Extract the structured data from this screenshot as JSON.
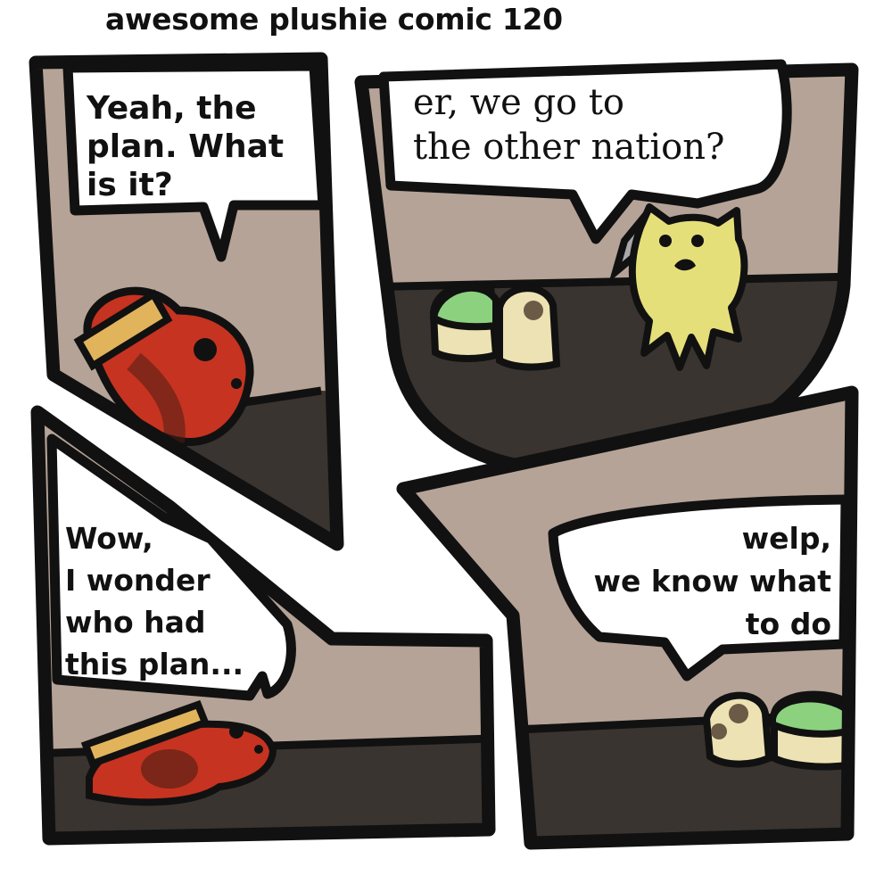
{
  "title": "awesome plushie comic 120",
  "panels": [
    {
      "bubble_text": "Yeah,  the\nplan. What\nis it?",
      "bubble_font": "sans"
    },
    {
      "bubble_text": "er, we go to\nthe other nation?",
      "bubble_font": "serif"
    },
    {
      "bubble_text": "Wow,\nI wonder\nwho had\nthis plan...",
      "bubble_font": "sans"
    },
    {
      "bubble_text": "welp,\nwe know what\nto do",
      "bubble_font": "sans"
    }
  ],
  "characters": [
    "red-plushie-icon",
    "turtle-plushie-icon",
    "yellow-cat-plushie-icon"
  ],
  "colors": {
    "wall": "#b5a397",
    "floor": "#3a3430",
    "outline": "#111111",
    "red": "#c63320",
    "yellow": "#e5df7a",
    "green": "#8bd17e",
    "cream": "#ece2b3",
    "hat": "#e1b45c"
  }
}
